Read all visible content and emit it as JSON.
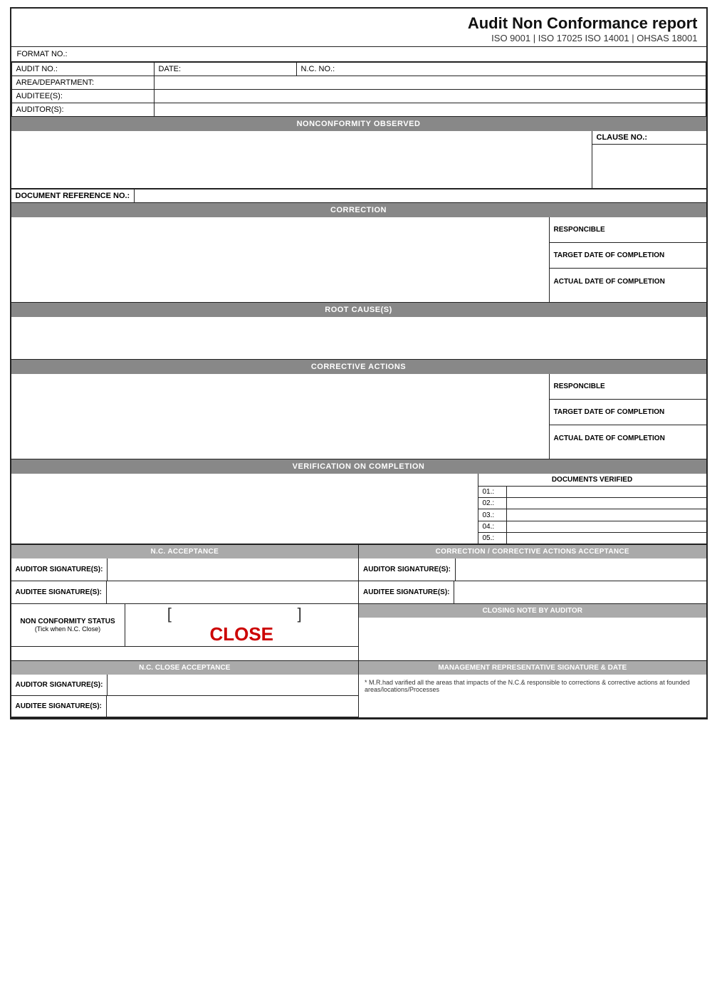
{
  "header": {
    "title": "Audit Non Conformance report",
    "subtitle": "ISO 9001 | ISO 17025 ISO 14001 | OHSAS 18001"
  },
  "format": {
    "label": "FORMAT NO.:"
  },
  "info_fields": {
    "audit_no_label": "AUDIT NO.:",
    "date_label": "DATE:",
    "nc_no_label": "N.C. NO.:",
    "area_dept_label": "AREA/DEPARTMENT:",
    "auditees_label": "AUDITEE(S):",
    "auditors_label": "AUDITOR(S):"
  },
  "sections": {
    "nonconformity": "NONCONFORMITY OBSERVED",
    "clause_no": "CLAUSE NO.:",
    "doc_ref": "DOCUMENT REFERENCE NO.:",
    "correction": "CORRECTION",
    "responsible1": "RESPONCIBLE",
    "target_date1": "TARGET DATE OF COMPLETION",
    "actual_date1": "ACTUAL DATE OF COMPLETION",
    "root_causes": "ROOT CAUSE(S)",
    "corrective_actions": "CORRECTIVE ACTIONS",
    "responsible2": "RESPONCIBLE",
    "target_date2": "TARGET DATE OF COMPLETION",
    "actual_date2": "ACTUAL DATE OF COMPLETION",
    "verification": "VERIFICATION ON COMPLETION",
    "docs_verified": "DOCUMENTS VERIFIED",
    "doc_rows": [
      "01.:",
      "02.:",
      "03.:",
      "04.:",
      "05.:"
    ]
  },
  "acceptance": {
    "nc_acceptance": "N.C. ACCEPTANCE",
    "corrective_acceptance": "CORRECTION / CORRECTIVE ACTIONS ACCEPTANCE",
    "auditor_sig": "AUDITOR SIGNATURE(S):",
    "auditee_sig": "AUDITEE SIGNATURE(S):",
    "nc_status_label": "NON CONFORMITY STATUS",
    "nc_status_sub": "(Tick when N.C. Close)",
    "close_bracket": "[          ]",
    "close_text": "CLOSE",
    "closing_note_header": "CLOSING NOTE BY AUDITOR"
  },
  "nc_close": {
    "nc_close_header": "N.C. CLOSE ACCEPTANCE",
    "mgmt_header": "MANAGEMENT REPRESENTATIVE SIGNATURE & DATE",
    "auditor_sig": "AUDITOR SIGNATURE(S):",
    "auditee_sig": "AUDITEE SIGNATURE(S):",
    "mgmt_note": "* M.R.had varified all the areas that impacts of the N.C.& responsible to corrections & corrective actions at founded areas/locations/Processes"
  }
}
